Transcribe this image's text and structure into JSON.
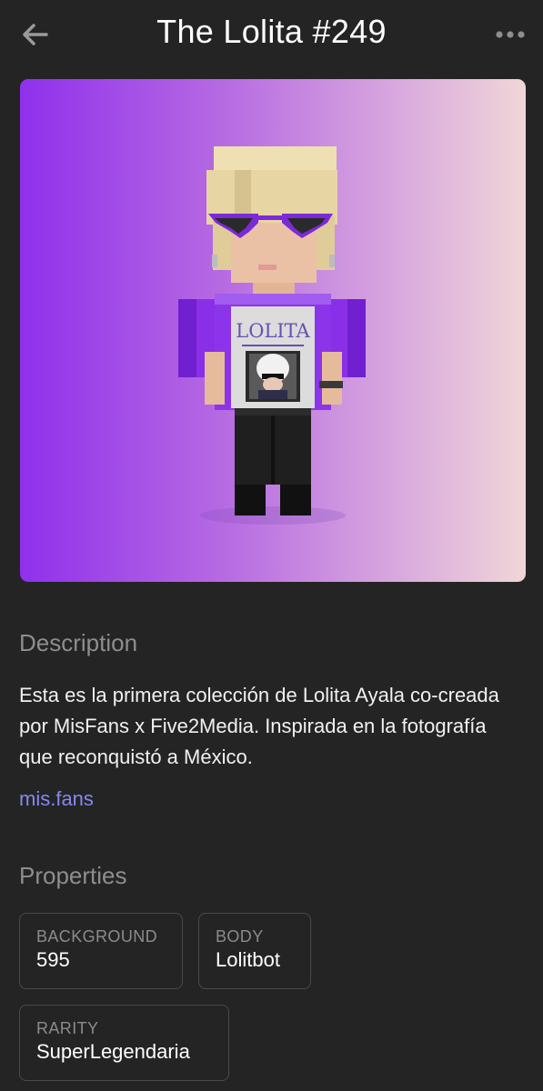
{
  "header": {
    "title": "The Lolita #249",
    "back_icon": "arrow-left-icon",
    "more_icon": "ellipsis-horizontal-icon"
  },
  "media": {
    "shirt_text": "LOLITA",
    "gradient": [
      "#9030ec",
      "#f0d6d8"
    ]
  },
  "description": {
    "heading": "Description",
    "text": "Esta es la primera colección de Lolita Ayala co-creada por MisFans x Five2Media. Inspirada en la fotografía que reconquistó a México.",
    "link": "mis.fans"
  },
  "properties": {
    "heading": "Properties",
    "items": [
      {
        "type": "BACKGROUND",
        "value": "595"
      },
      {
        "type": "BODY",
        "value": "Lolitbot"
      },
      {
        "type": "RARITY",
        "value": "SuperLegendaria"
      }
    ]
  },
  "colors": {
    "background": "#242424",
    "link": "#8a86f0",
    "muted": "#8e8e8e",
    "border": "#4a4a4a"
  }
}
